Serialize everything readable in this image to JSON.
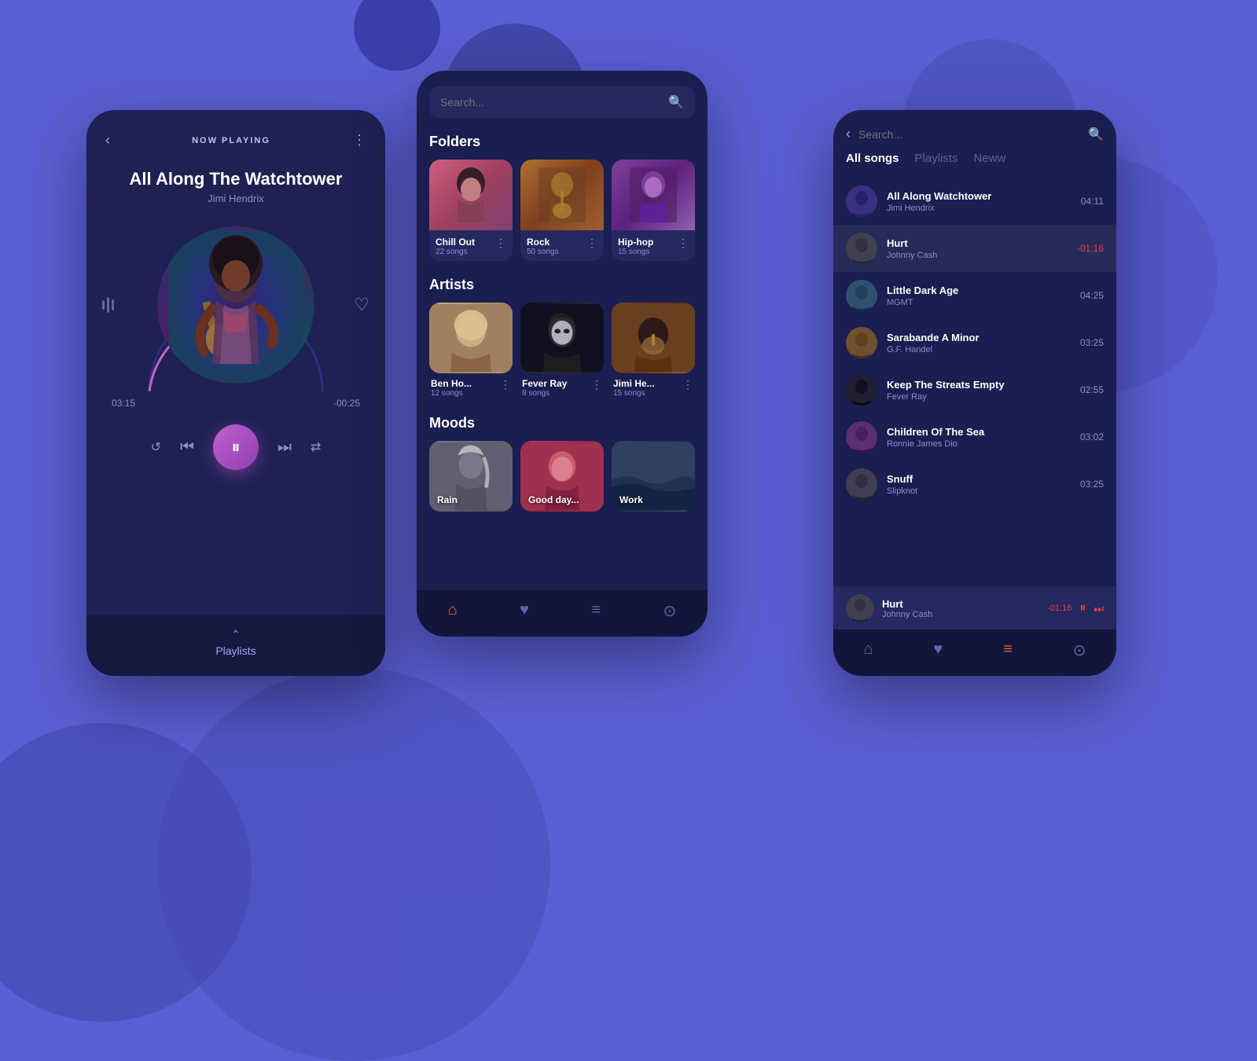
{
  "background": {
    "color": "#5b5fd4"
  },
  "phone1": {
    "header": {
      "back": "‹",
      "title": "NOW PLAYING",
      "more": "⋮"
    },
    "song": {
      "title": "All Along The Watchtower",
      "artist": "Jimi Hendrix"
    },
    "time": {
      "current": "03:15",
      "remaining": "-00:25"
    },
    "controls": {
      "repeat": "↺",
      "prev": "⏮",
      "pause": "⏸",
      "next": "⏭",
      "shuffle": "⇄"
    },
    "playlists_label": "Playlists"
  },
  "phone2": {
    "search_placeholder": "Search...",
    "sections": {
      "folders_label": "Folders",
      "artists_label": "Artists",
      "moods_label": "Moods"
    },
    "folders": [
      {
        "name": "Chill Out",
        "count": "22 songs",
        "color": "chill"
      },
      {
        "name": "Rock",
        "count": "50 songs",
        "color": "rock"
      },
      {
        "name": "Hip-hop",
        "count": "15 songs",
        "color": "hiphop"
      }
    ],
    "artists": [
      {
        "name": "Ben Ho...",
        "count": "12 songs",
        "color": "benho"
      },
      {
        "name": "Fever Ray",
        "count": "8 songs",
        "color": "feverray"
      },
      {
        "name": "Jimi He...",
        "count": "15 songs",
        "color": "jimihe"
      }
    ],
    "moods": [
      {
        "name": "Rain",
        "color": "rain"
      },
      {
        "name": "Good day...",
        "color": "goodday"
      },
      {
        "name": "Work",
        "color": "work"
      }
    ],
    "nav": {
      "home": "⌂",
      "heart": "♥",
      "list": "≡",
      "settings": "⊙"
    }
  },
  "phone3": {
    "search_placeholder": "Search...",
    "tabs": [
      {
        "label": "All songs",
        "active": true
      },
      {
        "label": "Playlists",
        "active": false
      },
      {
        "label": "Neww",
        "active": false
      }
    ],
    "songs": [
      {
        "title": "All Along Watchtower",
        "artist": "Jimi Hendrix",
        "duration": "04:11",
        "red": false
      },
      {
        "title": "Hurt",
        "artist": "Johnny Cash",
        "duration": "-01:16",
        "red": true,
        "active": true
      },
      {
        "title": "Little Dark Age",
        "artist": "MGMT",
        "duration": "04:25",
        "red": false
      },
      {
        "title": "Sarabande A Minor",
        "artist": "G.F. Handel",
        "duration": "03:25",
        "red": false
      },
      {
        "title": "Keep The Streats Empty",
        "artist": "Fever Ray",
        "duration": "02:55",
        "red": false
      },
      {
        "title": "Children Of The Sea",
        "artist": "Ronnie James Dio",
        "duration": "03:02",
        "red": false
      },
      {
        "title": "Snuff",
        "artist": "Slipknot",
        "duration": "03:25",
        "red": false
      }
    ],
    "mini_player": {
      "title": "Hurt",
      "artist": "Johnny Cash",
      "time": "-01:16"
    },
    "nav": {
      "home": "⌂",
      "heart": "♥",
      "list": "≡",
      "settings": "⊙"
    }
  }
}
